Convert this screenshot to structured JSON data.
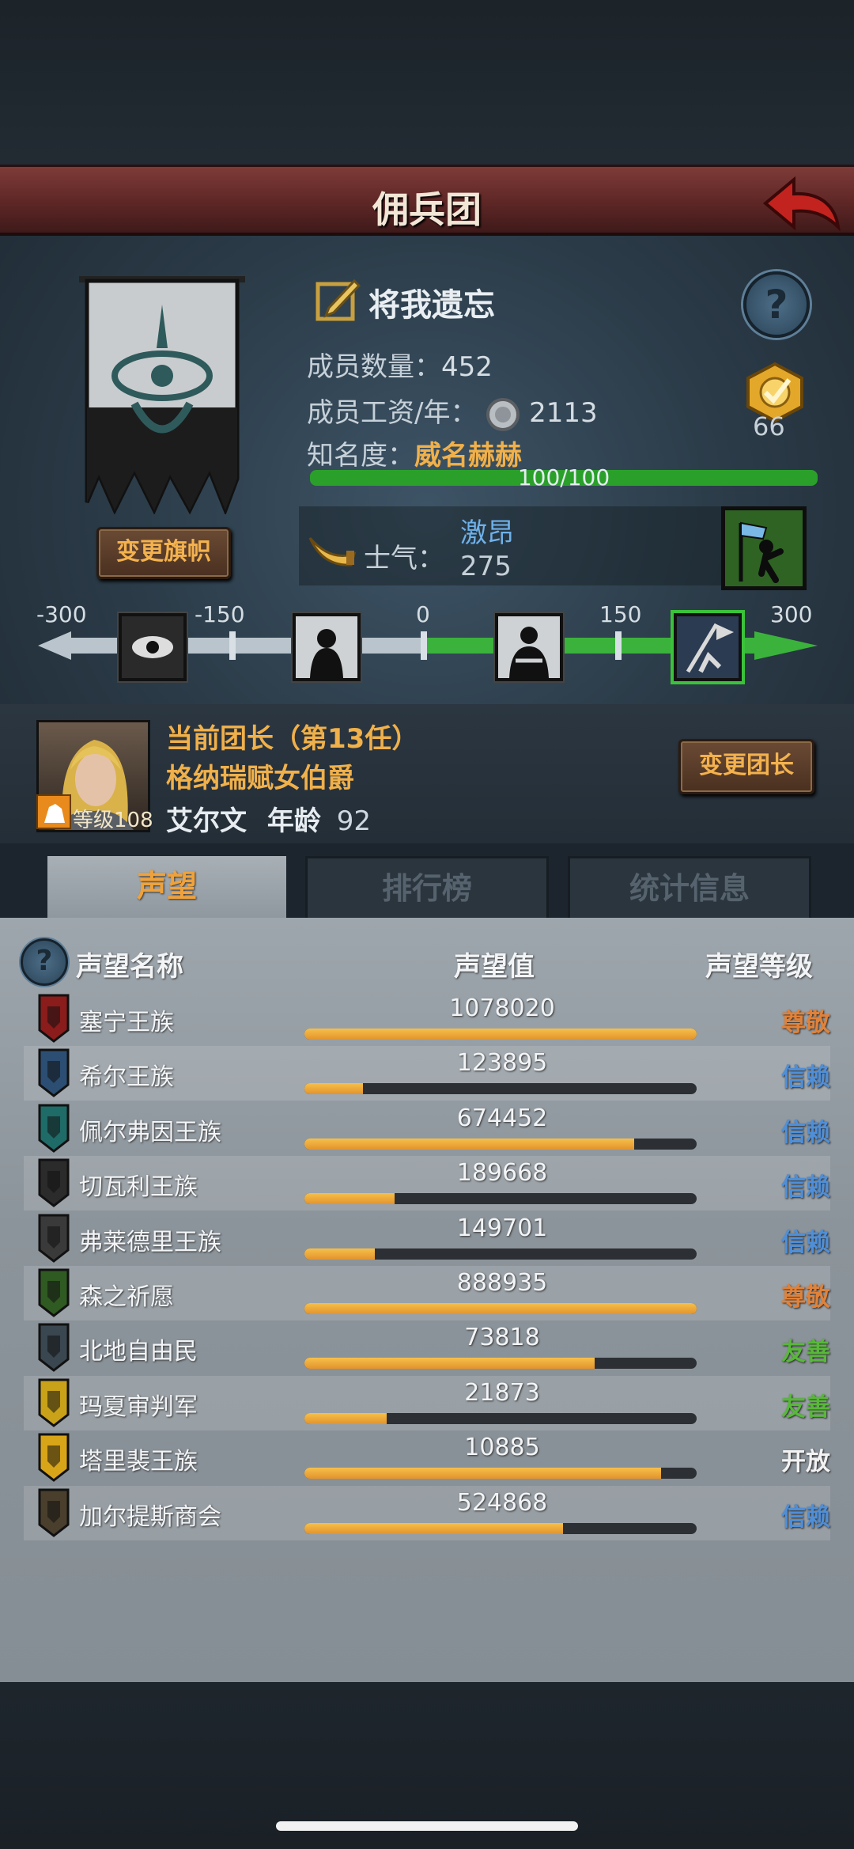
{
  "header": {
    "title": "佣兵团"
  },
  "band": {
    "name": "将我遗忘",
    "members_label": "成员数量：",
    "members": "452",
    "wage_label": "成员工资/年：",
    "wage": "2113",
    "fame_label": "知名度：",
    "fame_value": "威名赫赫",
    "fame_progress": "100/100",
    "fame_fraction": 1.0,
    "badge_count": "66",
    "change_flag": "变更旗帜"
  },
  "morale": {
    "label": "士气：",
    "state": "激昂",
    "value": "275",
    "ticks": [
      "-300",
      "-150",
      "0",
      "150",
      "300"
    ]
  },
  "leader": {
    "title": "当前团长（第13任）",
    "rank": "格纳瑞赋女伯爵",
    "level_label": "等级",
    "level": "108",
    "name": "艾尔文",
    "age_label": "年龄",
    "age": "92",
    "change_leader": "变更团长"
  },
  "tabs": [
    "声望",
    "排行榜",
    "统计信息"
  ],
  "table": {
    "headers": [
      "声望名称",
      "声望值",
      "声望等级"
    ],
    "rows": [
      {
        "name": "塞宁王族",
        "value": "1078020",
        "fill": 1.0,
        "level": "尊敬",
        "level_color": "#e0823a",
        "crest_color": "#8a1c1c"
      },
      {
        "name": "希尔王族",
        "value": "123895",
        "fill": 0.15,
        "level": "信赖",
        "level_color": "#4f8fd8",
        "crest_color": "#2c4e72"
      },
      {
        "name": "佩尔弗因王族",
        "value": "674452",
        "fill": 0.84,
        "level": "信赖",
        "level_color": "#4f8fd8",
        "crest_color": "#1f6b68"
      },
      {
        "name": "切瓦利王族",
        "value": "189668",
        "fill": 0.23,
        "level": "信赖",
        "level_color": "#4f8fd8",
        "crest_color": "#2b2b2b"
      },
      {
        "name": "弗莱德里王族",
        "value": "149701",
        "fill": 0.18,
        "level": "信赖",
        "level_color": "#4f8fd8",
        "crest_color": "#3a3a3a"
      },
      {
        "name": "森之祈愿",
        "value": "888935",
        "fill": 1.0,
        "level": "尊敬",
        "level_color": "#e0823a",
        "crest_color": "#2f5a22"
      },
      {
        "name": "北地自由民",
        "value": "73818",
        "fill": 0.74,
        "level": "友善",
        "level_color": "#58b83a",
        "crest_color": "#3a4650"
      },
      {
        "name": "玛夏审判军",
        "value": "21873",
        "fill": 0.21,
        "level": "友善",
        "level_color": "#58b83a",
        "crest_color": "#c9a21a"
      },
      {
        "name": "塔里裴王族",
        "value": "10885",
        "fill": 0.91,
        "level": "开放",
        "level_color": "#f2f2f2",
        "crest_color": "#d9a518"
      },
      {
        "name": "加尔提斯商会",
        "value": "524868",
        "fill": 0.66,
        "level": "信赖",
        "level_color": "#4f8fd8",
        "crest_color": "#4a3e2c"
      }
    ]
  }
}
